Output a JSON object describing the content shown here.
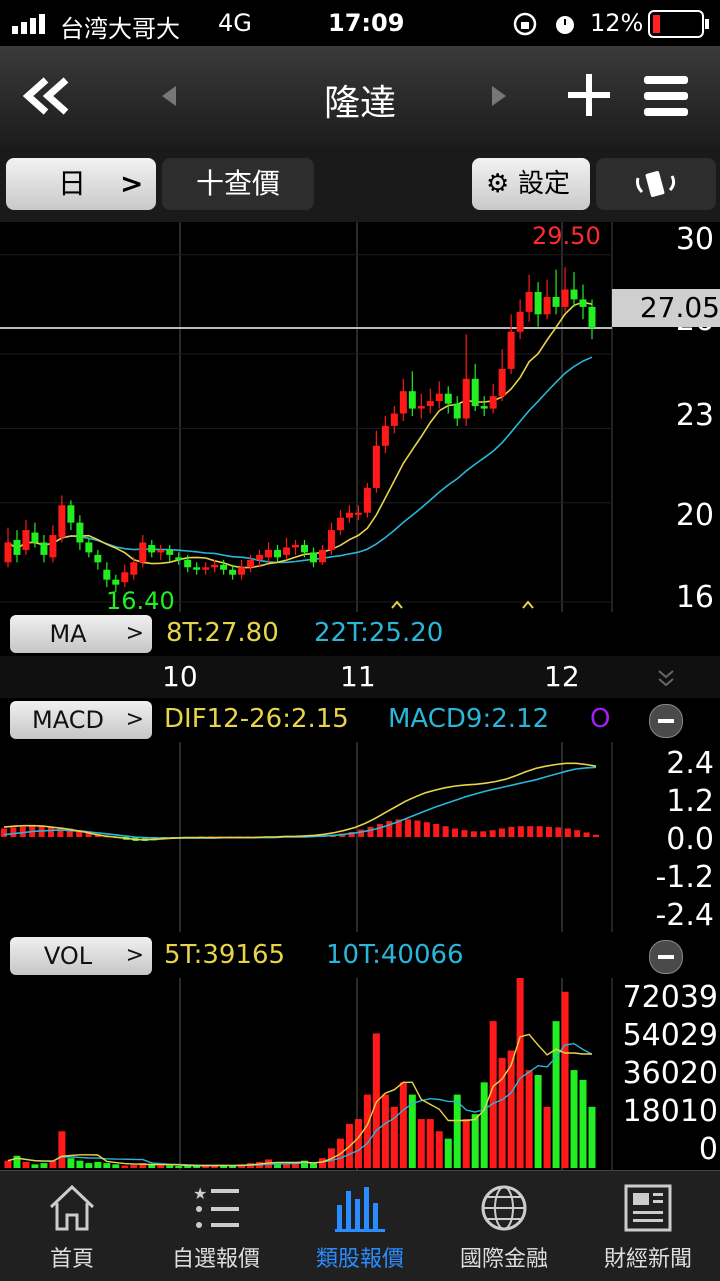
{
  "status_bar": {
    "carrier": "台湾大哥大",
    "network": "4G",
    "time": "17:09",
    "battery": "12%"
  },
  "nav": {
    "title": "隆達"
  },
  "toolbar": {
    "period_label": "日",
    "quote_label": "十查價",
    "settings_label": "設定"
  },
  "price_chart": {
    "high_label": "29.50",
    "low_label": "16.40",
    "current_price": "27.05",
    "y_ticks": [
      "30",
      "26",
      "23",
      "20",
      "16"
    ],
    "colors": {
      "up": "#ff1a1a",
      "down": "#22ee22",
      "ma8": "#e8d44a",
      "ma22": "#29b6d9",
      "high_label": "#ff2a2a",
      "low_label": "#22ee22"
    }
  },
  "ma_legend": {
    "name": "MA",
    "ma8": "8T:27.80",
    "ma22": "22T:25.20"
  },
  "x_axis": {
    "labels": [
      "10",
      "11",
      "12"
    ]
  },
  "macd_legend": {
    "name": "MACD",
    "dif": "DIF12-26:2.15",
    "macd": "MACD9:2.12",
    "osc": "O"
  },
  "macd_axis": [
    "2.4",
    "1.2",
    "0.0",
    "-1.2",
    "-2.4"
  ],
  "vol_legend": {
    "name": "VOL",
    "ma5": "5T:39165",
    "ma10": "10T:40066"
  },
  "vol_axis": [
    "72039",
    "54029",
    "36020",
    "18010",
    "0"
  ],
  "tabs": [
    {
      "label": "首頁",
      "icon": "home-icon"
    },
    {
      "label": "自選報價",
      "icon": "list-star-icon"
    },
    {
      "label": "類股報價",
      "icon": "bar-chart-icon"
    },
    {
      "label": "國際金融",
      "icon": "globe-icon"
    },
    {
      "label": "財經新聞",
      "icon": "newspaper-icon"
    }
  ],
  "chart_data": [
    {
      "type": "candlestick",
      "title": "",
      "x_labels": [
        "10",
        "11",
        "12"
      ],
      "y_ticks": [
        16,
        20,
        23,
        26,
        30
      ],
      "ylim": [
        16,
        31
      ],
      "series": [
        {
          "name": "8T",
          "values": []
        },
        {
          "name": "22T",
          "values": []
        }
      ],
      "candles": [
        [
          17.6,
          18.4,
          19.0,
          17.4
        ],
        [
          18.5,
          17.9,
          18.9,
          17.6
        ],
        [
          18.1,
          18.9,
          19.3,
          17.9
        ],
        [
          18.8,
          18.4,
          19.2,
          18.2
        ],
        [
          18.4,
          17.9,
          18.7,
          17.6
        ],
        [
          17.8,
          18.7,
          19.1,
          17.6
        ],
        [
          18.6,
          19.9,
          20.3,
          18.4
        ],
        [
          19.9,
          19.2,
          20.1,
          18.9
        ],
        [
          19.2,
          18.4,
          19.5,
          18.1
        ],
        [
          18.4,
          18.0,
          18.6,
          17.8
        ],
        [
          17.9,
          17.6,
          18.1,
          17.3
        ],
        [
          17.3,
          16.9,
          17.6,
          16.6
        ],
        [
          16.9,
          16.7,
          17.1,
          16.4
        ],
        [
          16.8,
          17.2,
          17.5,
          16.6
        ],
        [
          17.1,
          17.6,
          17.8,
          16.9
        ],
        [
          17.6,
          18.4,
          18.7,
          17.4
        ],
        [
          18.3,
          18.0,
          18.5,
          17.8
        ],
        [
          18.0,
          18.1,
          18.3,
          17.7
        ],
        [
          18.1,
          17.9,
          18.3,
          17.6
        ],
        [
          17.8,
          17.7,
          18.0,
          17.5
        ],
        [
          17.7,
          17.4,
          17.9,
          17.2
        ],
        [
          17.4,
          17.3,
          17.6,
          17.1
        ],
        [
          17.3,
          17.4,
          17.6,
          17.1
        ],
        [
          17.4,
          17.5,
          17.7,
          17.2
        ],
        [
          17.5,
          17.3,
          17.7,
          17.1
        ],
        [
          17.3,
          17.1,
          17.5,
          16.9
        ],
        [
          17.1,
          17.4,
          17.7,
          16.9
        ],
        [
          17.4,
          17.7,
          17.9,
          17.2
        ],
        [
          17.7,
          17.9,
          18.1,
          17.4
        ],
        [
          17.8,
          18.1,
          18.4,
          17.6
        ],
        [
          18.1,
          17.8,
          18.3,
          17.6
        ],
        [
          17.9,
          18.2,
          18.6,
          17.7
        ],
        [
          18.2,
          18.3,
          18.5,
          17.9
        ],
        [
          18.3,
          18.0,
          18.5,
          17.8
        ],
        [
          18.0,
          17.6,
          18.2,
          17.4
        ],
        [
          17.6,
          18.1,
          18.3,
          17.5
        ],
        [
          18.1,
          18.9,
          19.2,
          17.9
        ],
        [
          18.9,
          19.4,
          19.7,
          18.7
        ],
        [
          19.4,
          19.6,
          19.9,
          19.2
        ],
        [
          19.6,
          19.6,
          19.9,
          19.3
        ],
        [
          19.6,
          20.6,
          20.8,
          19.4
        ],
        [
          20.6,
          22.3,
          22.9,
          20.4
        ],
        [
          22.3,
          23.1,
          23.5,
          22.0
        ],
        [
          23.1,
          23.6,
          23.9,
          22.8
        ],
        [
          23.6,
          24.5,
          25.0,
          23.3
        ],
        [
          24.5,
          23.8,
          25.3,
          23.5
        ],
        [
          23.8,
          23.9,
          24.4,
          23.4
        ],
        [
          23.9,
          24.1,
          24.6,
          23.6
        ],
        [
          24.1,
          24.4,
          24.9,
          23.8
        ],
        [
          24.4,
          24.0,
          24.7,
          23.6
        ],
        [
          24.0,
          23.4,
          24.3,
          23.1
        ],
        [
          23.4,
          25.0,
          26.8,
          23.1
        ],
        [
          25.0,
          23.9,
          25.6,
          23.7
        ],
        [
          23.9,
          23.8,
          24.3,
          23.5
        ],
        [
          23.8,
          24.3,
          24.8,
          23.6
        ],
        [
          24.3,
          25.4,
          26.2,
          24.1
        ],
        [
          25.4,
          26.9,
          27.6,
          25.2
        ],
        [
          26.9,
          27.7,
          28.2,
          26.6
        ],
        [
          27.7,
          28.5,
          29.2,
          27.3
        ],
        [
          28.5,
          27.6,
          28.9,
          27.1
        ],
        [
          27.6,
          28.3,
          29.0,
          27.4
        ],
        [
          28.3,
          27.9,
          29.4,
          27.6
        ],
        [
          27.9,
          28.6,
          29.5,
          27.7
        ],
        [
          28.6,
          28.2,
          29.3,
          27.9
        ],
        [
          28.2,
          27.9,
          28.8,
          27.4
        ],
        [
          27.9,
          27.05,
          28.2,
          26.6
        ]
      ]
    },
    {
      "type": "bar",
      "title": "MACD",
      "series": [
        {
          "name": "DIF12-26",
          "last": 2.15
        },
        {
          "name": "MACD9",
          "last": 2.12
        }
      ],
      "y_ticks": [
        -2.4,
        -1.2,
        0.0,
        1.2,
        2.4
      ],
      "ylim": [
        -3.0,
        3.0
      ],
      "osc": [
        0.3,
        0.34,
        0.36,
        0.38,
        0.38,
        0.36,
        0.34,
        0.3,
        0.24,
        0.16,
        0.08,
        0.02,
        -0.04,
        -0.1,
        -0.14,
        -0.14,
        -0.12,
        -0.08,
        -0.04,
        -0.02,
        0,
        0.02,
        0.02,
        0.02,
        0.02,
        0.02,
        0.02,
        0.02,
        0.02,
        0.02,
        0.02,
        0.02,
        0.02,
        0.04,
        0.06,
        0.08,
        0.12,
        0.18,
        0.26,
        0.36,
        0.46,
        0.56,
        0.62,
        0.62,
        0.58,
        0.52,
        0.46,
        0.38,
        0.3,
        0.24,
        0.2,
        0.2,
        0.24,
        0.3,
        0.36,
        0.38,
        0.38,
        0.38,
        0.36,
        0.34,
        0.3,
        0.24,
        0.16,
        0.08
      ],
      "dif": [
        0.35,
        0.38,
        0.4,
        0.4,
        0.38,
        0.34,
        0.3,
        0.24,
        0.18,
        0.1,
        0.04,
        0,
        -0.04,
        -0.08,
        -0.1,
        -0.08,
        -0.06,
        -0.04,
        -0.02,
        -0.02,
        -0.02,
        -0.02,
        -0.02,
        -0.02,
        -0.02,
        -0.02,
        0,
        0,
        0.02,
        0.02,
        0.04,
        0.06,
        0.1,
        0.16,
        0.24,
        0.34,
        0.48,
        0.66,
        0.86,
        1.06,
        1.26,
        1.42,
        1.56,
        1.66,
        1.74,
        1.8,
        1.84,
        1.86,
        1.9,
        1.96,
        2.04,
        2.16,
        2.3,
        2.42,
        2.5,
        2.56,
        2.6,
        2.6,
        2.56,
        2.5
      ],
      "macd": [
        0.08,
        0.12,
        0.16,
        0.2,
        0.22,
        0.24,
        0.24,
        0.22,
        0.2,
        0.16,
        0.12,
        0.08,
        0.04,
        0,
        -0.02,
        -0.04,
        -0.04,
        -0.04,
        -0.04,
        -0.04,
        -0.04,
        -0.04,
        -0.02,
        -0.02,
        -0.02,
        -0.02,
        -0.02,
        -0.02,
        0,
        0,
        0,
        0.02,
        0.04,
        0.06,
        0.1,
        0.14,
        0.2,
        0.28,
        0.38,
        0.5,
        0.64,
        0.78,
        0.92,
        1.06,
        1.18,
        1.3,
        1.42,
        1.52,
        1.62,
        1.7,
        1.78,
        1.86,
        1.94,
        2.02,
        2.12,
        2.22,
        2.32,
        2.4,
        2.44,
        2.46
      ]
    },
    {
      "type": "bar",
      "title": "VOL",
      "series": [
        {
          "name": "5T",
          "last": 39165
        },
        {
          "name": "10T",
          "last": 40066
        }
      ],
      "y_ticks": [
        0,
        18010,
        36020,
        54029,
        72039
      ],
      "ylim": [
        0,
        72039
      ],
      "values": [
        3000,
        5000,
        2500,
        1500,
        2000,
        3000,
        15000,
        4000,
        3000,
        2000,
        2500,
        2000,
        1500,
        1000,
        1200,
        2000,
        1500,
        1000,
        1000,
        800,
        900,
        1000,
        900,
        1200,
        1000,
        900,
        1500,
        2000,
        2500,
        3500,
        2000,
        1500,
        2000,
        3000,
        2000,
        4000,
        8000,
        12000,
        18000,
        20000,
        30000,
        55000,
        30000,
        25000,
        35000,
        30000,
        20000,
        20000,
        15000,
        12000,
        30000,
        20000,
        22000,
        35000,
        60000,
        45000,
        48000,
        80000,
        40000,
        38000,
        25000,
        60000,
        72000,
        40000,
        36000,
        25000
      ]
    }
  ]
}
